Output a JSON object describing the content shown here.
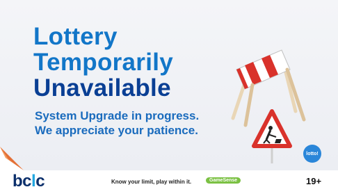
{
  "banner": {
    "headline": [
      "Lottery",
      "Temporarily",
      "Unavailable"
    ],
    "subtitle": [
      "System Upgrade in progress.",
      "We appreciate your patience."
    ],
    "badge_label": "lotto!"
  },
  "footer": {
    "brand": {
      "left": "bc",
      "accent": "l",
      "right": "c"
    },
    "responsible_text": "Know your limit, play within it.",
    "gamesense_label": "GameSense",
    "age_label": "19+"
  },
  "colors": {
    "headline_blue": "#1276c8",
    "headline_navy": "#0a3f94",
    "barrier_red": "#d9322b",
    "sign_red": "#d9322b",
    "gamesense_green": "#7bc143",
    "brand_navy": "#0b2f6b"
  },
  "icons": [
    "construction-barrier-icon",
    "men-at-work-sign-icon",
    "page-peel-icon"
  ]
}
